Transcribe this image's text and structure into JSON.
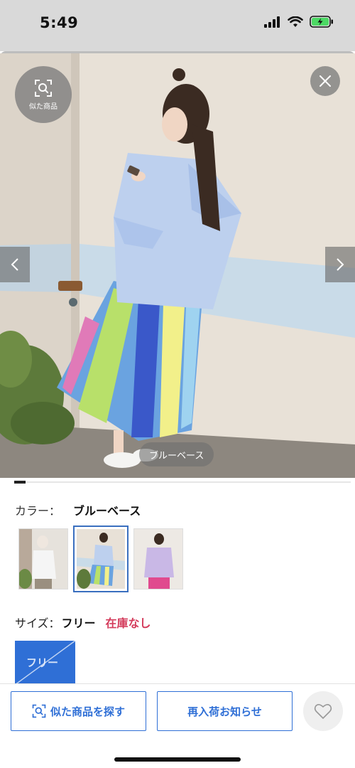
{
  "status_bar": {
    "time": "5:49",
    "icons": [
      "signal-icon",
      "wifi-icon",
      "battery-charging-icon"
    ]
  },
  "hero": {
    "similar_badge_label": "似た商品",
    "close_icon": "close-icon",
    "prev_icon": "chevron-left-icon",
    "next_icon": "chevron-right-icon",
    "color_caption": "ブルーベース"
  },
  "color": {
    "label": "カラー：",
    "value": "ブルーベース",
    "selected_index": 1,
    "swatch_count": 3
  },
  "size": {
    "label": "サイズ：",
    "value": "フリー",
    "stock_status": "在庫なし",
    "options": [
      "フリー"
    ]
  },
  "actions": {
    "find_similar_label": "似た商品を探す",
    "restock_notify_label": "再入荷お知らせ",
    "favorite_icon": "heart-icon"
  },
  "colors": {
    "accent": "#2f6fd6",
    "out_of_stock": "#d43c5c"
  }
}
